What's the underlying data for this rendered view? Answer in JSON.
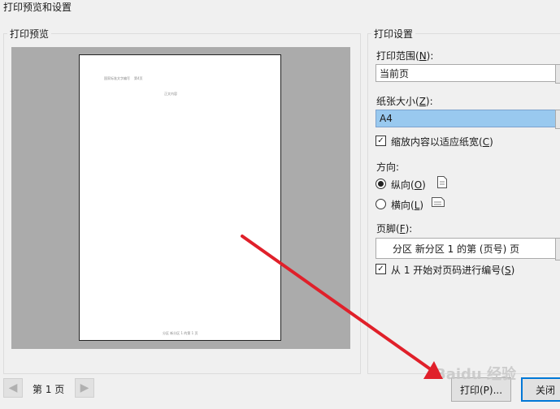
{
  "window": {
    "title": "打印预览和设置"
  },
  "preview": {
    "group_label": "打印预览",
    "page": {
      "header_left": "国家标准文字编写",
      "header_right": "第4页",
      "body_line": "正文内容",
      "footer": "分区 新分区 1 的第 1 页"
    }
  },
  "settings": {
    "group_label": "打印设置",
    "print_range": {
      "label": "打印范围(",
      "key": "N",
      "label_end": "):",
      "value": "当前页"
    },
    "paper_size": {
      "label": "纸张大小(",
      "key": "Z",
      "label_end": "):",
      "value": "A4"
    },
    "fit_width": {
      "label": "缩放内容以适应纸宽(",
      "key": "C",
      "label_end": ")",
      "checked": true
    },
    "orientation": {
      "label": "方向:",
      "portrait": {
        "label": "纵向(",
        "key": "O",
        "label_end": ")",
        "selected": true
      },
      "landscape": {
        "label": "横向(",
        "key": "L",
        "label_end": ")",
        "selected": false
      }
    },
    "footer": {
      "label": "页脚(",
      "key": "F",
      "label_end": "):",
      "value": "分区 新分区 1 的第 (页号) 页"
    },
    "number_from_one": {
      "label": "从 1 开始对页码进行编号(",
      "key": "S",
      "label_end": ")",
      "checked": true
    }
  },
  "navigation": {
    "prev_icon": "◀",
    "next_icon": "▶",
    "page_text": "第 1 页"
  },
  "buttons": {
    "print": "打印(P)...",
    "close": "关闭"
  },
  "watermark": "Baidu 经验",
  "annotation": {
    "arrow_color": "#e0202a"
  },
  "colors": {
    "selection": "#99c9ef",
    "preview_bg": "#ababab",
    "accent": "#0078d7"
  }
}
